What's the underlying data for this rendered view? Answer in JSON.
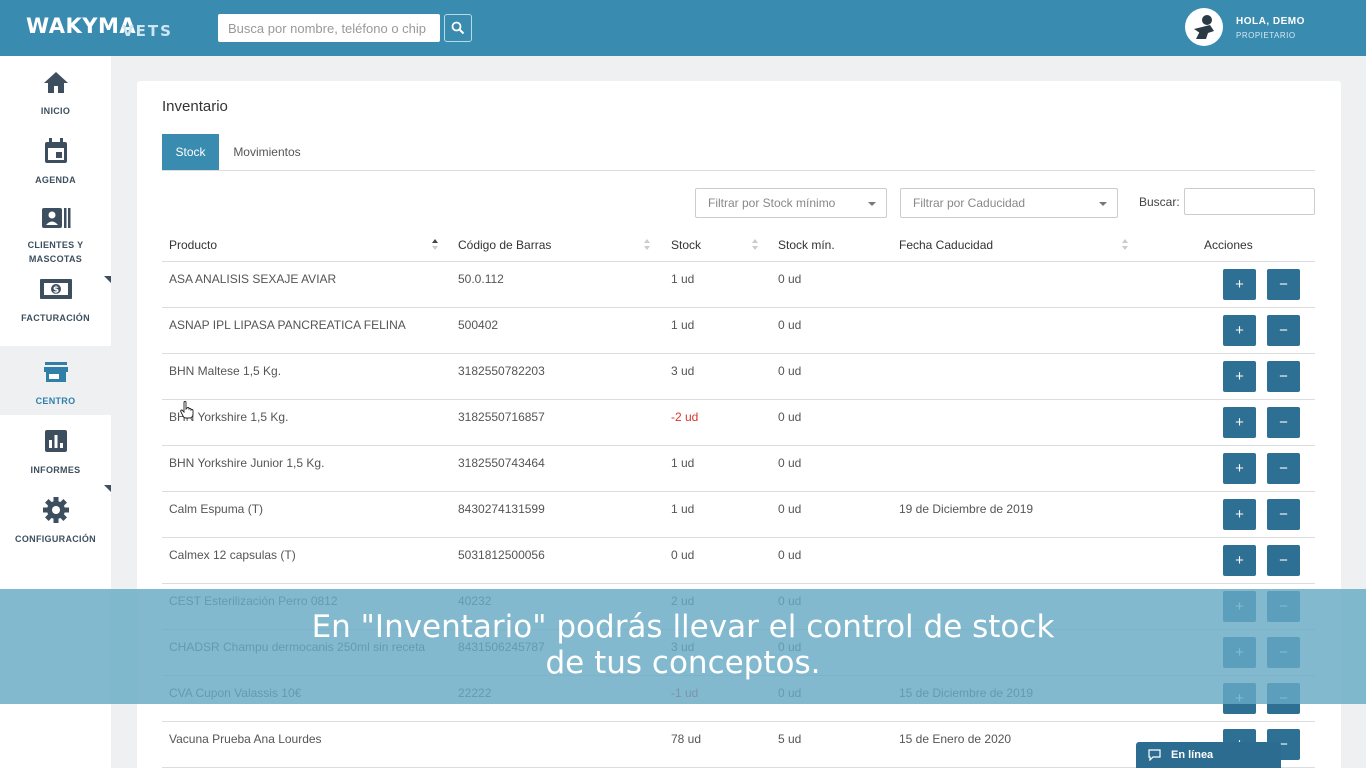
{
  "header": {
    "logo": "WAKYMA",
    "logo_sub": "VETS",
    "search_placeholder": "Busca por nombre, teléfono o chip",
    "greeting": "HOLA, DEMO",
    "role": "PROPIETARIO"
  },
  "sidebar": {
    "items": [
      {
        "label": "INICIO",
        "icon": "home-icon"
      },
      {
        "label": "AGENDA",
        "icon": "calendar-icon"
      },
      {
        "label": "CLIENTES Y MASCOTAS",
        "icon": "contacts-icon"
      },
      {
        "label": "FACTURACIÓN",
        "icon": "money-icon"
      },
      {
        "label": "CENTRO",
        "icon": "store-icon",
        "active": true
      },
      {
        "label": "INFORMES",
        "icon": "chart-icon"
      },
      {
        "label": "CONFIGURACIÓN",
        "icon": "gear-icon"
      }
    ]
  },
  "page": {
    "title": "Inventario",
    "tabs": [
      {
        "label": "Stock",
        "active": true
      },
      {
        "label": "Movimientos",
        "active": false
      }
    ],
    "filters": {
      "stock_min": "Filtrar por Stock mínimo",
      "caducidad": "Filtrar por Caducidad",
      "buscar_label": "Buscar:"
    }
  },
  "table": {
    "columns": [
      "Producto",
      "Código de Barras",
      "Stock",
      "Stock mín.",
      "Fecha Caducidad",
      "Acciones"
    ],
    "rows": [
      {
        "producto": "ASA ANALISIS SEXAJE AVIAR",
        "codigo": "50.0.112",
        "stock": "1 ud",
        "min": "0 ud",
        "fecha": ""
      },
      {
        "producto": "ASNAP IPL LIPASA PANCREATICA FELINA",
        "codigo": "500402",
        "stock": "1 ud",
        "min": "0 ud",
        "fecha": ""
      },
      {
        "producto": "BHN Maltese 1,5 Kg.",
        "codigo": "3182550782203",
        "stock": "3 ud",
        "min": "0 ud",
        "fecha": ""
      },
      {
        "producto": "BHN Yorkshire 1,5 Kg.",
        "codigo": "3182550716857",
        "stock": "-2 ud",
        "min": "0 ud",
        "fecha": ""
      },
      {
        "producto": "BHN Yorkshire Junior 1,5 Kg.",
        "codigo": "3182550743464",
        "stock": "1 ud",
        "min": "0 ud",
        "fecha": ""
      },
      {
        "producto": "Calm Espuma (T)",
        "codigo": "8430274131599",
        "stock": "1 ud",
        "min": "0 ud",
        "fecha": "19 de Diciembre de 2019"
      },
      {
        "producto": "Calmex 12 capsulas (T)",
        "codigo": "5031812500056",
        "stock": "0 ud",
        "min": "0 ud",
        "fecha": ""
      },
      {
        "producto": "CEST Esterilización Perro 0812",
        "codigo": "40232",
        "stock": "2 ud",
        "min": "0 ud",
        "fecha": ""
      },
      {
        "producto": "CHADSR Champu dermocanis 250ml sin receta",
        "codigo": "8431506245787",
        "stock": "3 ud",
        "min": "0 ud",
        "fecha": ""
      },
      {
        "producto": "CVA Cupon Valassis 10€",
        "codigo": "22222",
        "stock": "-1 ud",
        "min": "0 ud",
        "fecha": "15 de Diciembre de 2019"
      },
      {
        "producto": "Vacuna Prueba Ana Lourdes",
        "codigo": "",
        "stock": "78 ud",
        "min": "5 ud",
        "fecha": "15 de Enero de 2020"
      }
    ],
    "add_symbol": "+",
    "remove_symbol": "−"
  },
  "overlay": {
    "line1": "En \"Inventario\" podrás llevar el control de stock",
    "line2": "de tus conceptos."
  },
  "chat": {
    "label": "En línea"
  }
}
